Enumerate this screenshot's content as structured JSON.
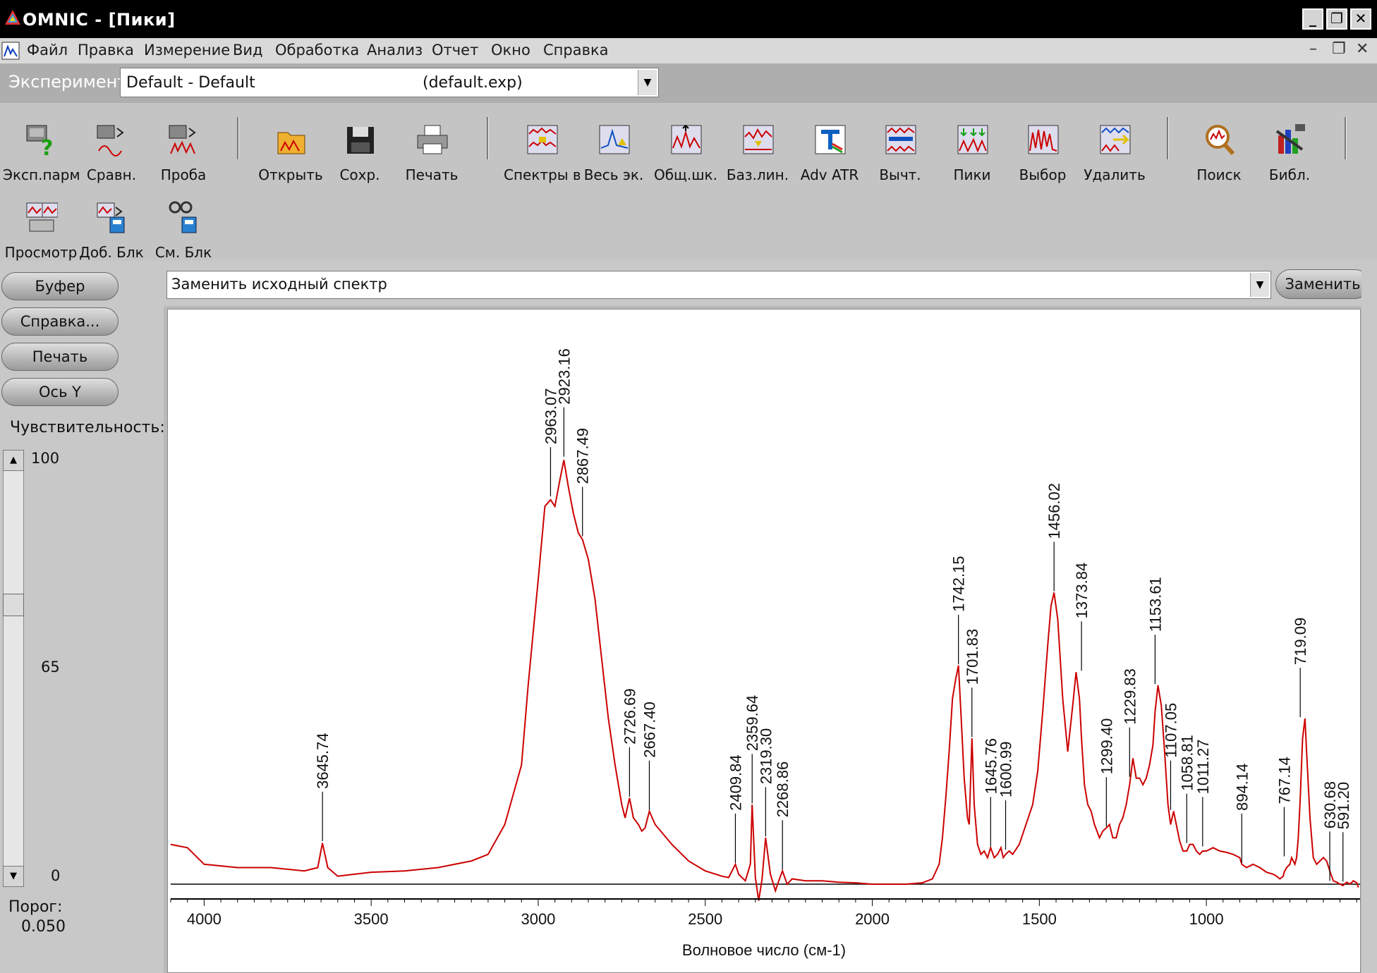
{
  "window": {
    "title": "OMNIC - [Пики]",
    "btn_min": "_",
    "btn_restore": "❐",
    "btn_close": "✕"
  },
  "menu": {
    "items": [
      "Файл",
      "Правка",
      "Измерение",
      "Вид",
      "Обработка",
      "Анализ",
      "Отчет",
      "Окно",
      "Справка"
    ],
    "mdi_min": "–",
    "mdi_restore": "❐",
    "mdi_close": "✕"
  },
  "experiment": {
    "label": "Эксперимент",
    "name": "Default - Default",
    "file": "(default.exp)"
  },
  "toolbar": {
    "row1": [
      "Эксп.парм",
      "Сравн.",
      "Проба",
      "Открыть",
      "Сохр.",
      "Печать",
      "Спектры в",
      "Весь эк.",
      "Общ.шк.",
      "Баз.лин.",
      "Adv ATR",
      "Вычт.",
      "Пики",
      "Выбор",
      "Удалить",
      "Поиск",
      "Библ."
    ],
    "row2": [
      "Просмотр",
      "Доб. Блк",
      "См. Блк"
    ]
  },
  "side_buttons": [
    "Буфер",
    "Справка...",
    "Печать",
    "Ось Y"
  ],
  "sensitivity": {
    "label": "Чувствительность:",
    "ticks": [
      "100",
      "65",
      "0"
    ],
    "value": 65
  },
  "threshold": {
    "label": "Порог:",
    "value": "0.050"
  },
  "replace": {
    "option": "Заменить исходный спектр",
    "button": "Заменить"
  },
  "chart_data": {
    "type": "line",
    "xlabel": "Волновое число (см-1)",
    "xlim": [
      4100,
      540
    ],
    "xticks": [
      4000,
      3500,
      3000,
      2500,
      2000,
      1500,
      1000
    ],
    "series_color": "#cc0000",
    "x": [
      4100,
      4050,
      4000,
      3900,
      3800,
      3700,
      3660,
      3645.74,
      3630,
      3600,
      3550,
      3500,
      3400,
      3300,
      3200,
      3150,
      3100,
      3050,
      3030,
      3000,
      2980,
      2963.07,
      2950,
      2935,
      2923.16,
      2910,
      2895,
      2880,
      2867.49,
      2850,
      2830,
      2810,
      2790,
      2770,
      2750,
      2740,
      2726.69,
      2715,
      2700,
      2690,
      2680,
      2667.4,
      2650,
      2600,
      2550,
      2500,
      2450,
      2430,
      2409.84,
      2400,
      2380,
      2365,
      2359.64,
      2350,
      2340,
      2330,
      2319.3,
      2305,
      2290,
      2280,
      2268.86,
      2255,
      2240,
      2200,
      2150,
      2100,
      2050,
      2000,
      1950,
      1900,
      1850,
      1820,
      1800,
      1790,
      1780,
      1770,
      1760,
      1750,
      1742.15,
      1735,
      1725,
      1715,
      1710,
      1701.83,
      1695,
      1685,
      1675,
      1665,
      1655,
      1645.76,
      1635,
      1625,
      1615,
      1608,
      1600.99,
      1590,
      1580,
      1560,
      1540,
      1520,
      1505,
      1490,
      1475,
      1465,
      1456.02,
      1445,
      1430,
      1415,
      1400,
      1390,
      1380,
      1373.84,
      1365,
      1355,
      1345,
      1335,
      1320,
      1310,
      1299.4,
      1290,
      1280,
      1270,
      1260,
      1250,
      1240,
      1229.83,
      1220,
      1210,
      1200,
      1190,
      1180,
      1170,
      1160,
      1153.61,
      1145,
      1135,
      1125,
      1115,
      1107.05,
      1098,
      1090,
      1080,
      1070,
      1058.81,
      1050,
      1040,
      1030,
      1020,
      1011.27,
      1000,
      980,
      960,
      940,
      920,
      900,
      894.14,
      880,
      860,
      840,
      820,
      800,
      790,
      780,
      770,
      767.14,
      760,
      750,
      745,
      740,
      735,
      730,
      725,
      719.09,
      712,
      705,
      700,
      690,
      680,
      670,
      660,
      650,
      640,
      630.68,
      620,
      610,
      600,
      591.2,
      580,
      570,
      560,
      550,
      545
    ],
    "y": [
      0.06,
      0.055,
      0.03,
      0.025,
      0.025,
      0.02,
      0.025,
      0.062,
      0.025,
      0.012,
      0.015,
      0.018,
      0.02,
      0.025,
      0.035,
      0.045,
      0.09,
      0.18,
      0.3,
      0.46,
      0.57,
      0.58,
      0.57,
      0.61,
      0.64,
      0.6,
      0.56,
      0.53,
      0.52,
      0.49,
      0.43,
      0.34,
      0.25,
      0.18,
      0.12,
      0.1,
      0.13,
      0.1,
      0.09,
      0.08,
      0.085,
      0.11,
      0.09,
      0.06,
      0.035,
      0.02,
      0.012,
      0.01,
      0.03,
      0.015,
      0.005,
      0.03,
      0.12,
      0.01,
      -0.025,
      0.008,
      0.07,
      0.015,
      -0.01,
      0.005,
      0.02,
      0.0,
      0.008,
      0.005,
      0.005,
      0.003,
      0.002,
      0.0,
      0.0,
      0.0,
      0.002,
      0.008,
      0.03,
      0.07,
      0.13,
      0.2,
      0.28,
      0.31,
      0.33,
      0.26,
      0.16,
      0.1,
      0.09,
      0.22,
      0.12,
      0.06,
      0.045,
      0.05,
      0.04,
      0.055,
      0.04,
      0.045,
      0.055,
      0.04,
      0.045,
      0.05,
      0.045,
      0.06,
      0.09,
      0.12,
      0.17,
      0.26,
      0.36,
      0.42,
      0.44,
      0.4,
      0.28,
      0.2,
      0.27,
      0.32,
      0.28,
      0.22,
      0.15,
      0.12,
      0.11,
      0.09,
      0.07,
      0.08,
      0.085,
      0.09,
      0.07,
      0.07,
      0.09,
      0.1,
      0.12,
      0.15,
      0.19,
      0.16,
      0.16,
      0.15,
      0.16,
      0.18,
      0.21,
      0.26,
      0.3,
      0.27,
      0.2,
      0.12,
      0.09,
      0.11,
      0.09,
      0.065,
      0.05,
      0.05,
      0.06,
      0.06,
      0.05,
      0.045,
      0.05,
      0.05,
      0.055,
      0.05,
      0.048,
      0.045,
      0.04,
      0.03,
      0.025,
      0.03,
      0.025,
      0.018,
      0.015,
      0.012,
      0.008,
      0.012,
      0.018,
      0.025,
      0.03,
      0.04,
      0.035,
      0.03,
      0.04,
      0.07,
      0.13,
      0.22,
      0.25,
      0.2,
      0.1,
      0.04,
      0.03,
      0.035,
      0.04,
      0.035,
      0.02,
      0.005,
      0.003,
      0.0,
      -0.002,
      0.003,
      0.0,
      0.005,
      0.002,
      -0.005,
      0.01,
      0.02,
      0.03
    ],
    "peaks": [
      {
        "x": 3645.74,
        "label": "3645.74",
        "y": 0.065
      },
      {
        "x": 2963.07,
        "label": "2963.07",
        "y": 0.585
      },
      {
        "x": 2923.16,
        "label": "2923.16",
        "y": 0.645
      },
      {
        "x": 2867.49,
        "label": "2867.49",
        "y": 0.525
      },
      {
        "x": 2726.69,
        "label": "2726.69",
        "y": 0.132
      },
      {
        "x": 2667.4,
        "label": "2667.40",
        "y": 0.112
      },
      {
        "x": 2409.84,
        "label": "2409.84",
        "y": 0.032
      },
      {
        "x": 2359.64,
        "label": "2359.64",
        "y": 0.122
      },
      {
        "x": 2319.3,
        "label": "2319.30",
        "y": 0.072
      },
      {
        "x": 2268.86,
        "label": "2268.86",
        "y": 0.022
      },
      {
        "x": 1742.15,
        "label": "1742.15",
        "y": 0.332
      },
      {
        "x": 1701.83,
        "label": "1701.83",
        "y": 0.222
      },
      {
        "x": 1645.76,
        "label": "1645.76",
        "y": 0.057
      },
      {
        "x": 1600.99,
        "label": "1600.99",
        "y": 0.052
      },
      {
        "x": 1456.02,
        "label": "1456.02",
        "y": 0.442
      },
      {
        "x": 1373.84,
        "label": "1373.84",
        "y": 0.322
      },
      {
        "x": 1299.4,
        "label": "1299.40",
        "y": 0.087
      },
      {
        "x": 1229.83,
        "label": "1229.83",
        "y": 0.162
      },
      {
        "x": 1153.61,
        "label": "1153.61",
        "y": 0.302
      },
      {
        "x": 1107.05,
        "label": "1107.05",
        "y": 0.112
      },
      {
        "x": 1058.81,
        "label": "1058.81",
        "y": 0.062
      },
      {
        "x": 1011.27,
        "label": "1011.27",
        "y": 0.057
      },
      {
        "x": 894.14,
        "label": "894.14",
        "y": 0.032
      },
      {
        "x": 767.14,
        "label": "767.14",
        "y": 0.042
      },
      {
        "x": 719.09,
        "label": "719.09",
        "y": 0.252
      },
      {
        "x": 630.68,
        "label": "630.68",
        "y": 0.005
      },
      {
        "x": 591.2,
        "label": "591.20",
        "y": 0.004
      }
    ]
  }
}
